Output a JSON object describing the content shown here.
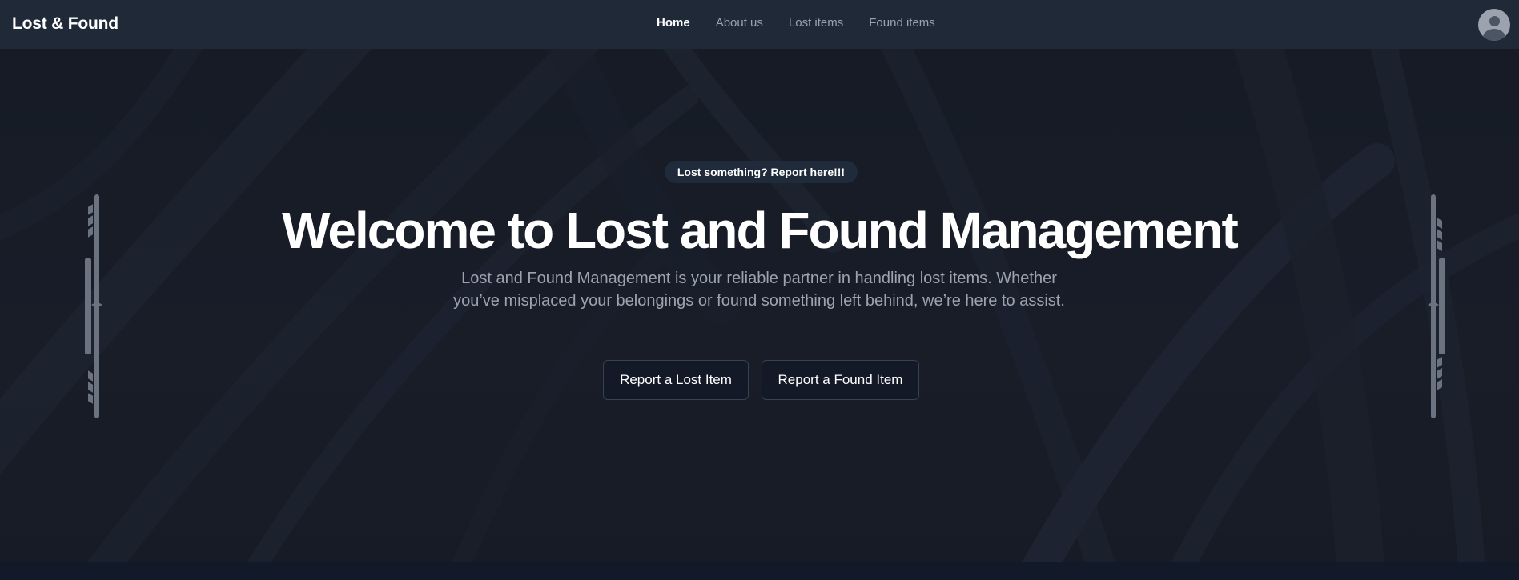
{
  "header": {
    "brand": "Lost & Found",
    "nav": [
      {
        "label": "Home",
        "active": true
      },
      {
        "label": "About us",
        "active": false
      },
      {
        "label": "Lost items",
        "active": false
      },
      {
        "label": "Found items",
        "active": false
      }
    ],
    "avatar_icon": "user-avatar-icon"
  },
  "hero": {
    "badge": "Lost something? Report here!!!",
    "title": "Welcome to Lost and Found Management",
    "description": "Lost and Found Management is your reliable partner in handling lost items. Whether you’ve misplaced your belongings or found something left behind, we’re here to assist.",
    "buttons": {
      "lost": "Report a Lost Item",
      "found": "Report a Found Item"
    }
  },
  "colors": {
    "nav_bg": "#1f2937",
    "page_bg": "#111827",
    "text_primary": "#ffffff",
    "text_muted": "#9ca3af",
    "button_border": "#374151"
  }
}
